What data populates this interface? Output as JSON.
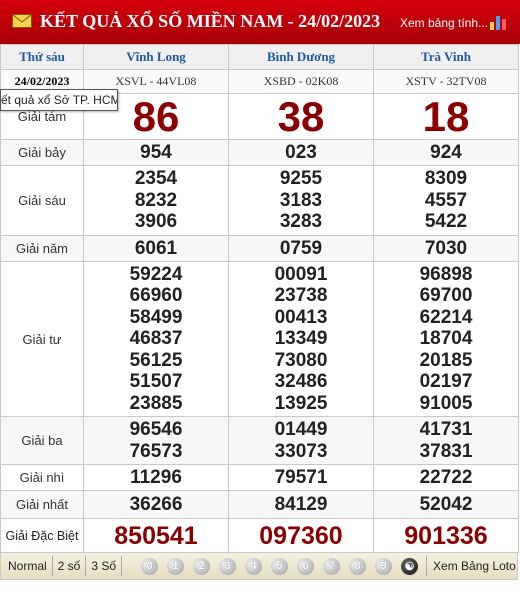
{
  "header": {
    "title": "KẾT QUẢ XỔ SỐ MIỀN NAM - 24/02/2023",
    "link": "Xem bảng tính...",
    "mail_icon": "mail-icon",
    "chart_icon": "bar-chart-icon"
  },
  "table": {
    "day": "Thứ sáu",
    "date": "24/02/2023",
    "provinces": [
      {
        "name": "Vĩnh Long",
        "code": "XSVL - 44VL08"
      },
      {
        "name": "Bình Dương",
        "code": "XSBD - 02K08"
      },
      {
        "name": "Trà Vinh",
        "code": "XSTV - 32TV08"
      }
    ],
    "prizes": [
      {
        "name": "Giải tám",
        "type": "big",
        "values": [
          [
            "86"
          ],
          [
            "38"
          ],
          [
            "18"
          ]
        ]
      },
      {
        "name": "Giải bảy",
        "values": [
          [
            "954"
          ],
          [
            "023"
          ],
          [
            "924"
          ]
        ]
      },
      {
        "name": "Giải sáu",
        "values": [
          [
            "2354",
            "8232",
            "3906"
          ],
          [
            "9255",
            "3183",
            "3283"
          ],
          [
            "8309",
            "4557",
            "5422"
          ]
        ]
      },
      {
        "name": "Giải năm",
        "values": [
          [
            "6061"
          ],
          [
            "0759"
          ],
          [
            "7030"
          ]
        ]
      },
      {
        "name": "Giải tư",
        "values": [
          [
            "59224",
            "66960",
            "58499",
            "46837",
            "56125",
            "51507",
            "23885"
          ],
          [
            "00091",
            "23738",
            "00413",
            "13349",
            "73080",
            "32486",
            "13925"
          ],
          [
            "96898",
            "69700",
            "62214",
            "18704",
            "20185",
            "02197",
            "91005"
          ]
        ]
      },
      {
        "name": "Giải ba",
        "values": [
          [
            "96546",
            "76573"
          ],
          [
            "01449",
            "33073"
          ],
          [
            "41731",
            "37831"
          ]
        ]
      },
      {
        "name": "Giải nhì",
        "values": [
          [
            "11296"
          ],
          [
            "79571"
          ],
          [
            "22722"
          ]
        ]
      },
      {
        "name": "Giải nhất",
        "values": [
          [
            "36266"
          ],
          [
            "84129"
          ],
          [
            "52042"
          ]
        ]
      },
      {
        "name": "Giải Đặc Biệt",
        "type": "db",
        "values": [
          [
            "850541"
          ],
          [
            "097360"
          ],
          [
            "901336"
          ]
        ]
      }
    ]
  },
  "tooltip": "ết quả xổ Sở TP. HCM",
  "footer": {
    "modes": [
      "Normal",
      "2 số",
      "3 Số"
    ],
    "digits": [
      "0",
      "1",
      "2",
      "3",
      "4",
      "5",
      "6",
      "7",
      "8",
      "9"
    ],
    "all_icon": "yin-yang-icon",
    "loto_link": "Xem Bảng Loto"
  }
}
